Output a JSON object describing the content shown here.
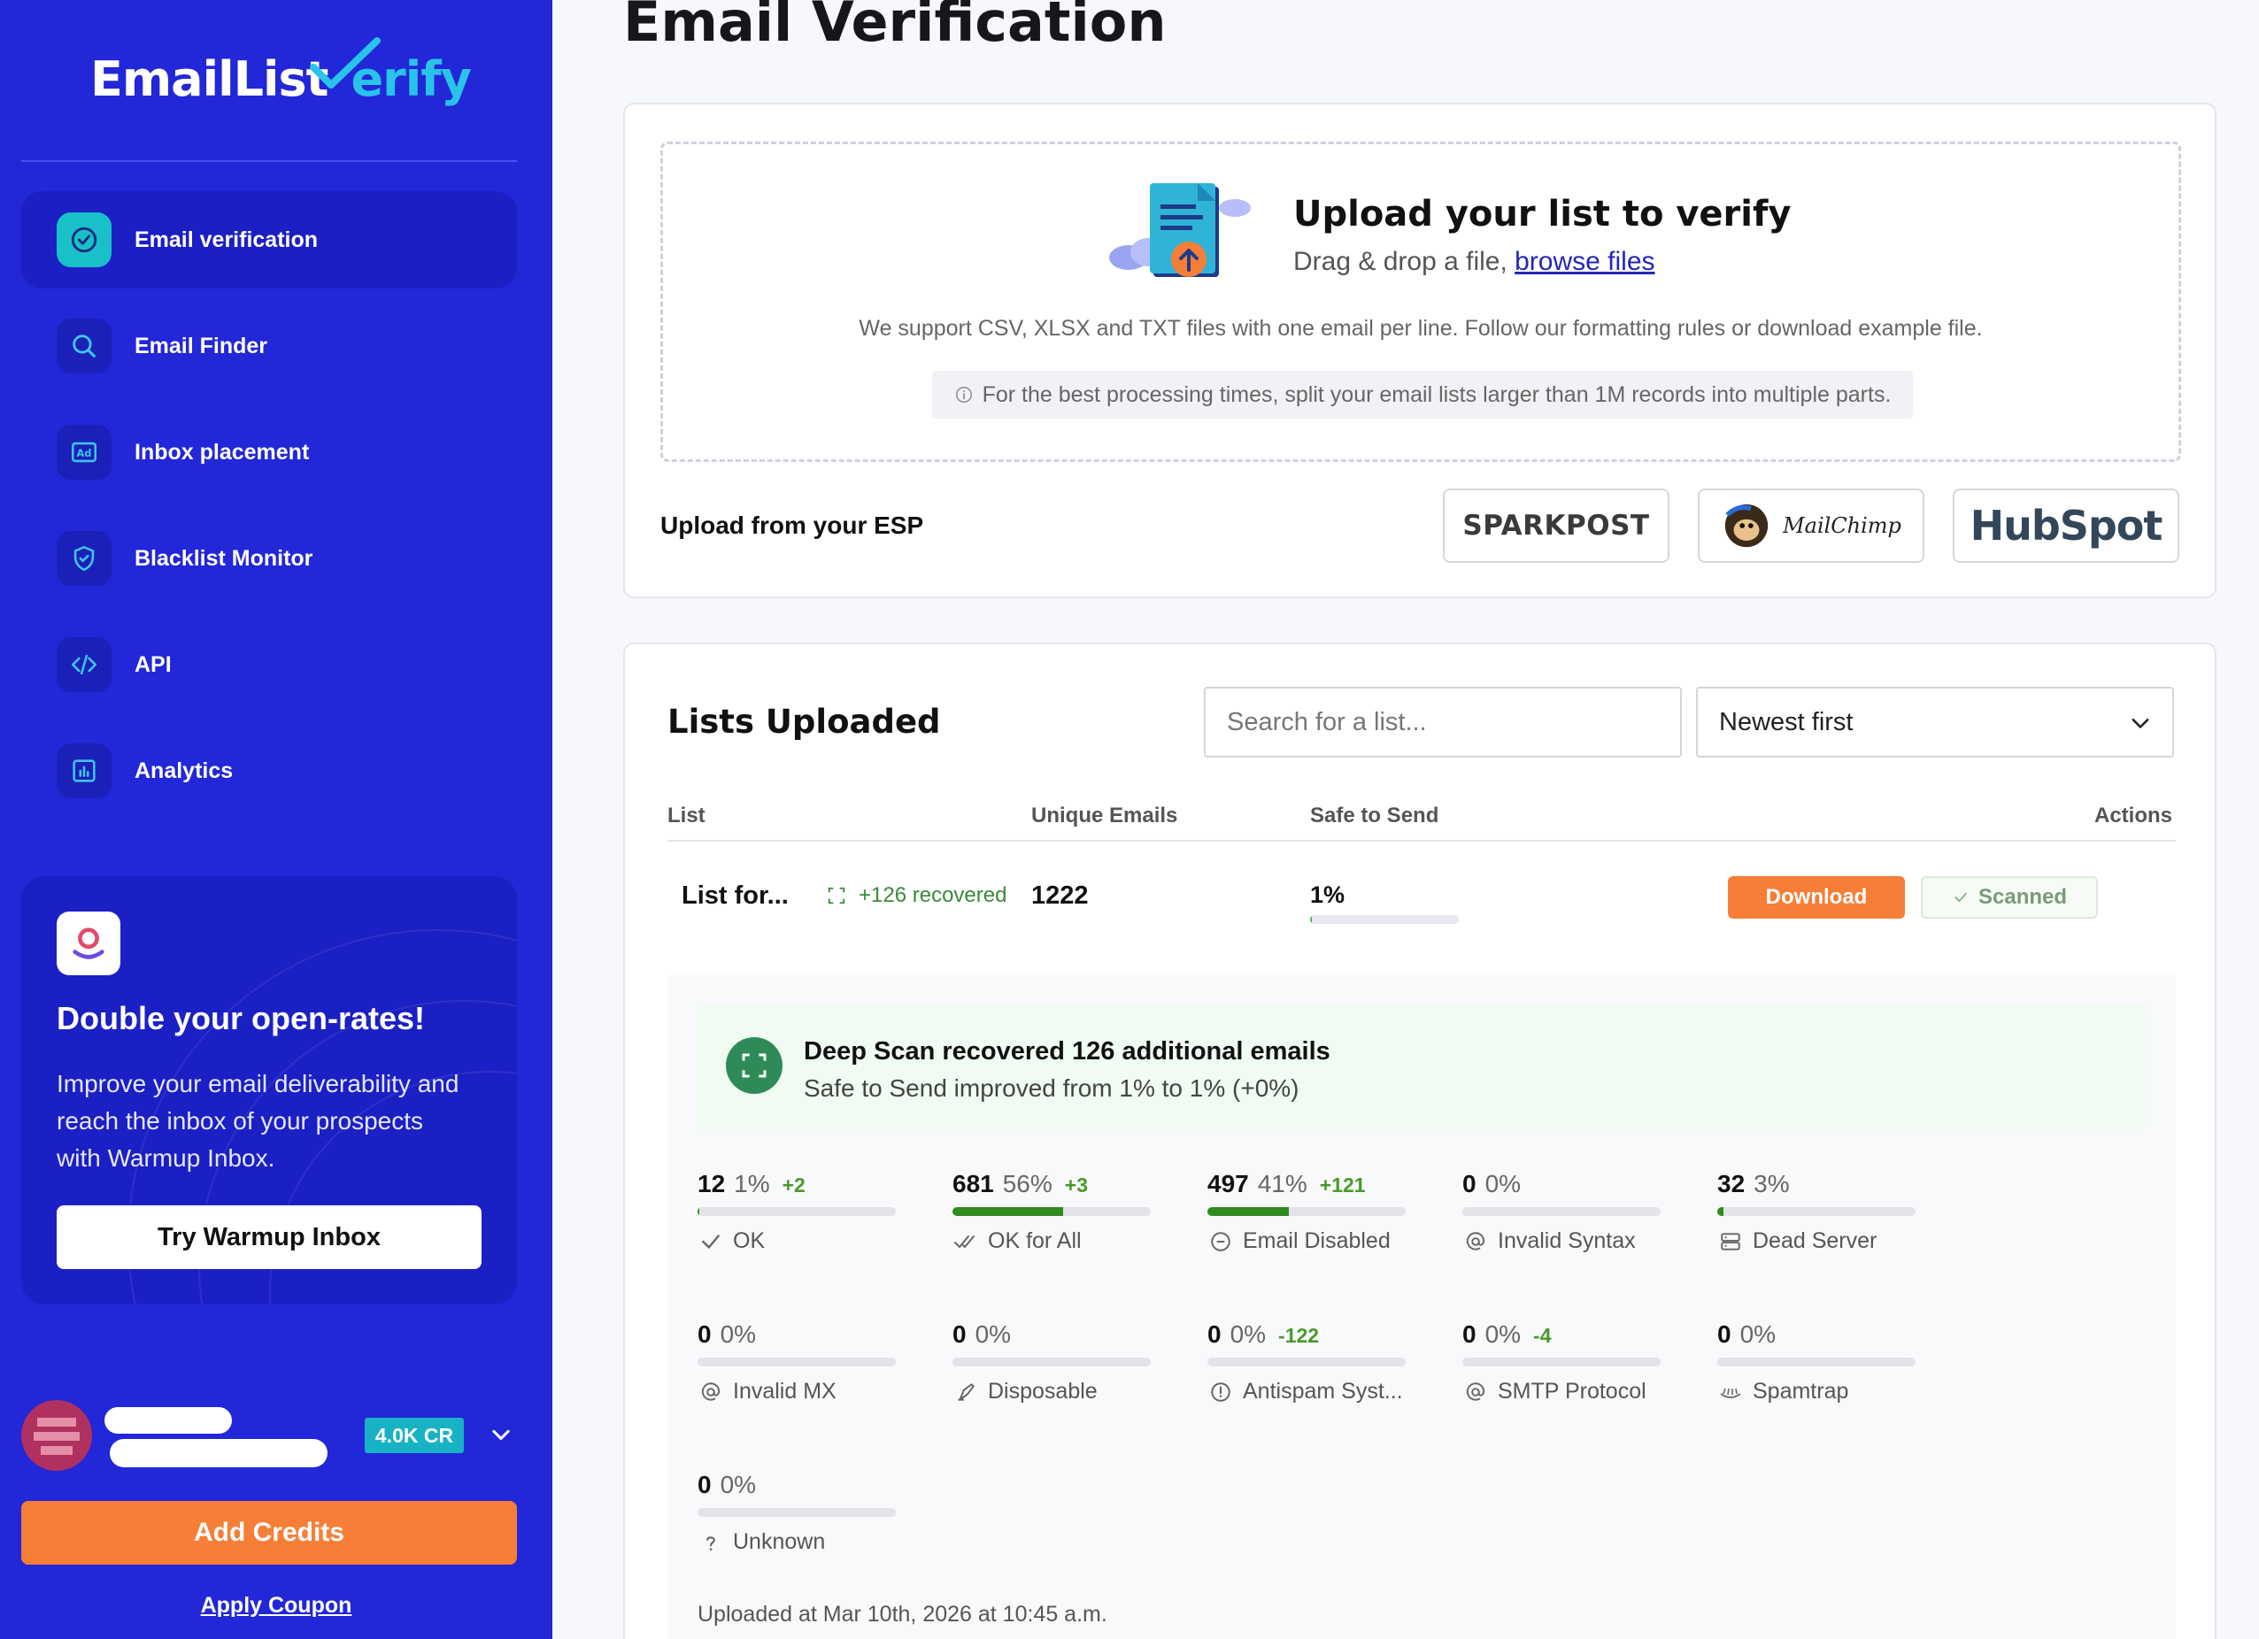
{
  "brand": {
    "name_part1": "EmailList",
    "name_part2": "erify",
    "accent": "#29c3ea",
    "sidebar_bg": "#2227d8"
  },
  "nav": [
    {
      "label": "Email verification",
      "icon": "check-circle-icon",
      "active": true
    },
    {
      "label": "Email Finder",
      "icon": "search-icon"
    },
    {
      "label": "Inbox placement",
      "icon": "ad-icon"
    },
    {
      "label": "Blacklist Monitor",
      "icon": "shield-icon"
    },
    {
      "label": "API",
      "icon": "code-icon"
    },
    {
      "label": "Analytics",
      "icon": "chart-icon"
    }
  ],
  "promo": {
    "title": "Double your open-rates!",
    "text": "Improve your email deliverability and reach the inbox of your prospects with Warmup Inbox.",
    "button": "Try Warmup Inbox"
  },
  "user": {
    "credits": "4.0K CR"
  },
  "sidebar_actions": {
    "add_credits": "Add Credits",
    "apply_coupon": "Apply Coupon"
  },
  "page_title": "Email Verification",
  "upload": {
    "title": "Upload your list to verify",
    "sub_prefix": "Drag & drop a file, ",
    "browse": "browse files",
    "formats": "We support CSV, XLSX and TXT files with one email per line. Follow our formatting rules or download example file.",
    "tip": "For the best processing times, split your email lists larger than 1M records into multiple parts.",
    "esp_label": "Upload from your ESP",
    "esp": [
      "SPARKPOST",
      "MailChimp",
      "HubSpot"
    ]
  },
  "lists": {
    "title": "Lists Uploaded",
    "search_placeholder": "Search for a list...",
    "sort": "Newest first",
    "columns": [
      "List",
      "Unique Emails",
      "Safe to Send",
      "Actions"
    ],
    "row": {
      "name": "List for...",
      "recovered": "+126 recovered",
      "unique": "1222",
      "safe": "1%",
      "safe_fraction": 0.01,
      "download": "Download",
      "scanned": "Scanned"
    },
    "deep_scan": {
      "title": "Deep Scan recovered 126 additional emails",
      "sub": "Safe to Send improved from 1% to 1% (+0%)"
    },
    "stats": [
      {
        "count": "12",
        "pct": "1%",
        "delta": "+2",
        "fill": 0.01,
        "label": "OK",
        "icon": "check-icon"
      },
      {
        "count": "681",
        "pct": "56%",
        "delta": "+3",
        "fill": 0.56,
        "label": "OK for All",
        "icon": "double-check-icon"
      },
      {
        "count": "497",
        "pct": "41%",
        "delta": "+121",
        "fill": 0.41,
        "label": "Email Disabled",
        "icon": "minus-circle-icon"
      },
      {
        "count": "0",
        "pct": "0%",
        "delta": "",
        "fill": 0,
        "label": "Invalid Syntax",
        "icon": "at-icon"
      },
      {
        "count": "32",
        "pct": "3%",
        "delta": "",
        "fill": 0.03,
        "label": "Dead Server",
        "icon": "server-icon"
      },
      {
        "count": "0",
        "pct": "0%",
        "delta": "",
        "fill": 0,
        "label": "Invalid MX",
        "icon": "at-icon"
      },
      {
        "count": "0",
        "pct": "0%",
        "delta": "",
        "fill": 0,
        "label": "Disposable",
        "icon": "disposable-icon"
      },
      {
        "count": "0",
        "pct": "0%",
        "delta": "-122",
        "fill": 0,
        "label": "Antispam Syst...",
        "icon": "alert-circle-icon"
      },
      {
        "count": "0",
        "pct": "0%",
        "delta": "-4",
        "fill": 0,
        "label": "SMTP Protocol",
        "icon": "at-icon"
      },
      {
        "count": "0",
        "pct": "0%",
        "delta": "",
        "fill": 0,
        "label": "Spamtrap",
        "icon": "spamtrap-icon"
      },
      {
        "count": "0",
        "pct": "0%",
        "delta": "",
        "fill": 0,
        "label": "Unknown",
        "icon": "question-icon"
      }
    ],
    "uploaded_at": "Uploaded at Mar 10th, 2026 at 10:45 a.m."
  }
}
